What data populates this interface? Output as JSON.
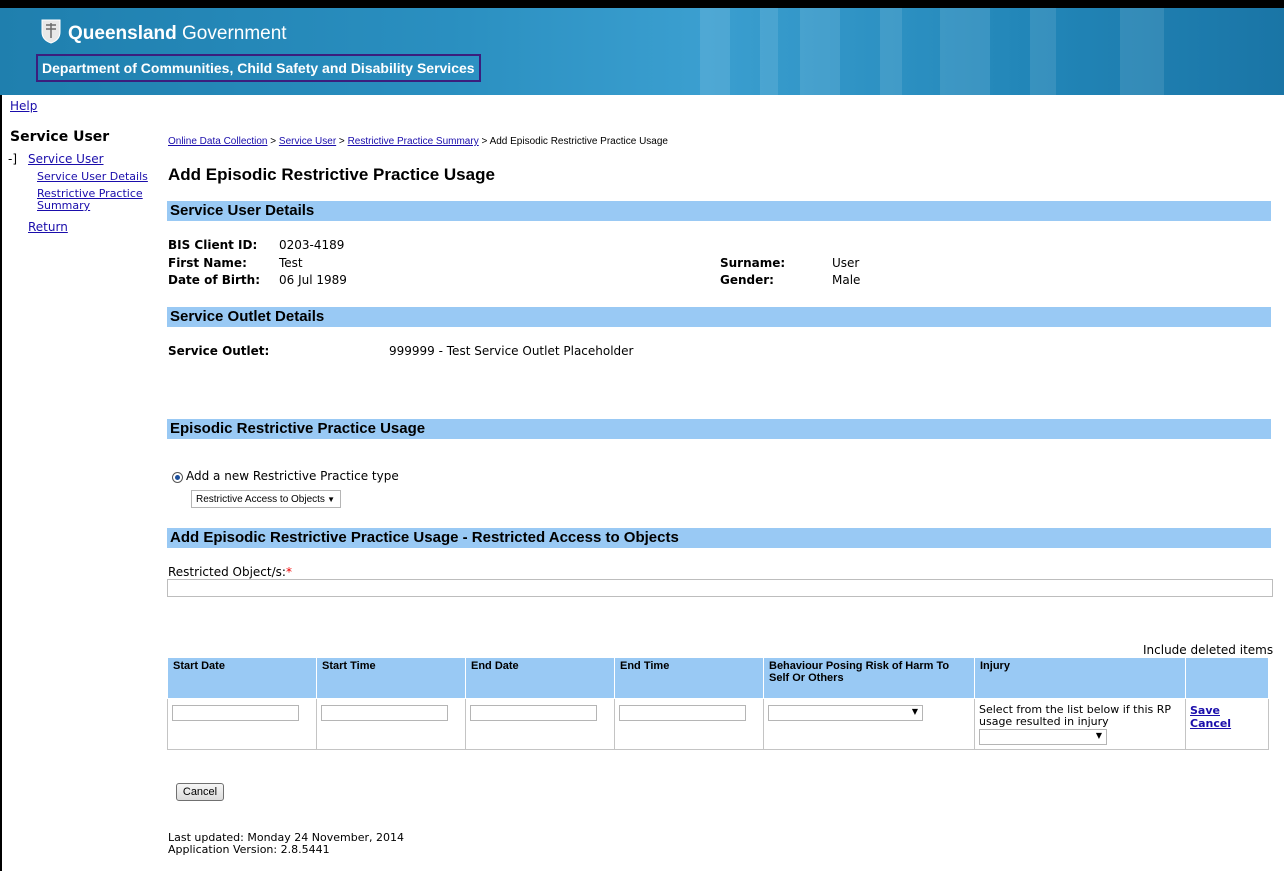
{
  "banner": {
    "brand_bold": "Queensland",
    "brand_rest": " Government",
    "department": "Department of Communities, Child Safety and Disability Services"
  },
  "help_link": "Help",
  "sidebar": {
    "title": "Service User",
    "bracket": "-]",
    "service_user": "Service User",
    "service_user_details": "Service User Details",
    "restrictive_practice_summary": "Restrictive Practice Summary",
    "return": "Return"
  },
  "breadcrumb": {
    "item1": "Online Data Collection",
    "sep": " > ",
    "item2": "Service User",
    "item3": "Restrictive Practice Summary",
    "current": "Add Episodic Restrictive Practice Usage"
  },
  "page_title": "Add Episodic Restrictive Practice Usage",
  "sections": {
    "service_user_details": "Service User Details",
    "service_outlet_details": "Service Outlet Details",
    "episodic_usage": "Episodic Restrictive Practice Usage",
    "add_usage_objects": "Add Episodic Restrictive Practice Usage - Restricted Access to Objects"
  },
  "user": {
    "bis_label": "BIS Client ID:",
    "bis_value": "0203-4189",
    "first_label": "First Name:",
    "first_value": "Test",
    "dob_label": "Date of Birth:",
    "dob_value": "06 Jul 1989",
    "surname_label": "Surname:",
    "surname_value": "User",
    "gender_label": "Gender:",
    "gender_value": "Male"
  },
  "outlet": {
    "label": "Service Outlet:",
    "value": "999999 - Test Service Outlet Placeholder"
  },
  "practice": {
    "radio_label": "Add a new Restrictive Practice type",
    "type_selected": "Restrictive Access to Objects"
  },
  "restricted_objects_label": "Restricted Object/s:",
  "required_mark": "*",
  "include_deleted": "Include deleted items",
  "grid": {
    "headers": {
      "start_date": "Start Date",
      "start_time": "Start Time",
      "end_date": "End Date",
      "end_time": "End Time",
      "behaviour": "Behaviour Posing Risk of Harm To Self Or Others",
      "injury": "Injury"
    },
    "injury_hint": "Select from the list below if this RP usage resulted in injury",
    "save": "Save",
    "cancel": "Cancel"
  },
  "cancel_button": "Cancel",
  "footer": {
    "last_updated": "Last updated: Monday 24 November, 2014",
    "version": "Application Version: 2.8.5441"
  },
  "colors": {
    "banner": "#2a8fc0",
    "section_bar": "#99c9f4",
    "department_border": "#3b1e7d",
    "link": "#1a0dab",
    "required": "#e00000"
  }
}
